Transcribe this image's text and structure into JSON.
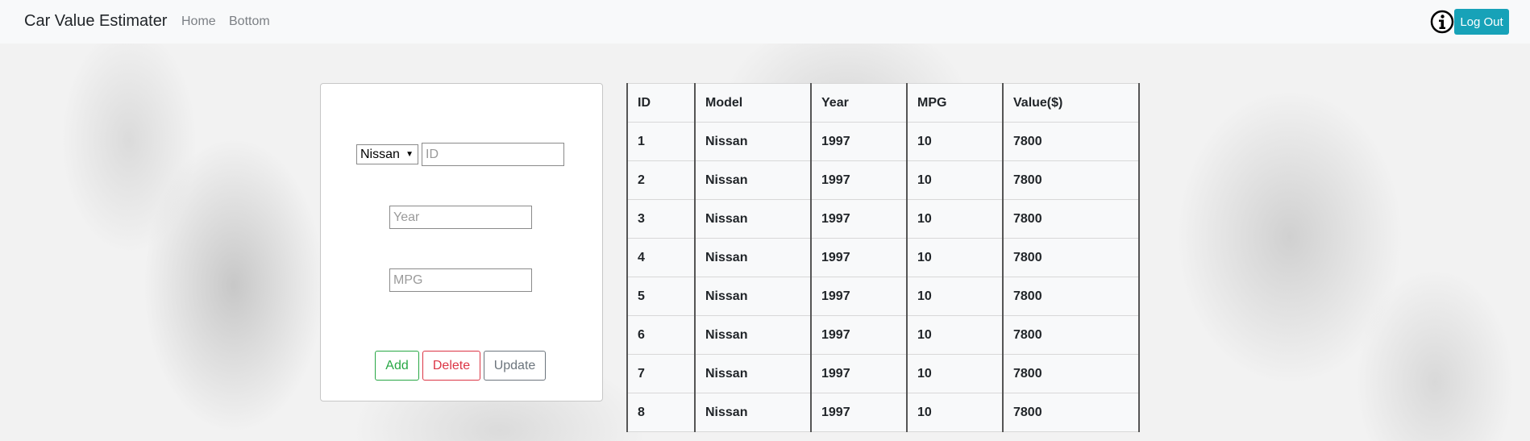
{
  "navbar": {
    "brand": "Car Value Estimater",
    "links": [
      "Home",
      "Bottom"
    ],
    "info_icon": "info-circle-icon",
    "logout_label": "Log Out",
    "logout_color": "#17a2b8"
  },
  "form": {
    "make_select": {
      "selected": "Nissan"
    },
    "id_placeholder": "ID",
    "year_placeholder": "Year",
    "mpg_placeholder": "MPG",
    "buttons": {
      "add": "Add",
      "delete": "Delete",
      "update": "Update"
    }
  },
  "table": {
    "headers": [
      "ID",
      "Model",
      "Year",
      "MPG",
      "Value($)"
    ],
    "rows": [
      [
        "1",
        "Nissan",
        "1997",
        "10",
        "7800"
      ],
      [
        "2",
        "Nissan",
        "1997",
        "10",
        "7800"
      ],
      [
        "3",
        "Nissan",
        "1997",
        "10",
        "7800"
      ],
      [
        "4",
        "Nissan",
        "1997",
        "10",
        "7800"
      ],
      [
        "5",
        "Nissan",
        "1997",
        "10",
        "7800"
      ],
      [
        "6",
        "Nissan",
        "1997",
        "10",
        "7800"
      ],
      [
        "7",
        "Nissan",
        "1997",
        "10",
        "7800"
      ],
      [
        "8",
        "Nissan",
        "1997",
        "10",
        "7800"
      ]
    ]
  }
}
